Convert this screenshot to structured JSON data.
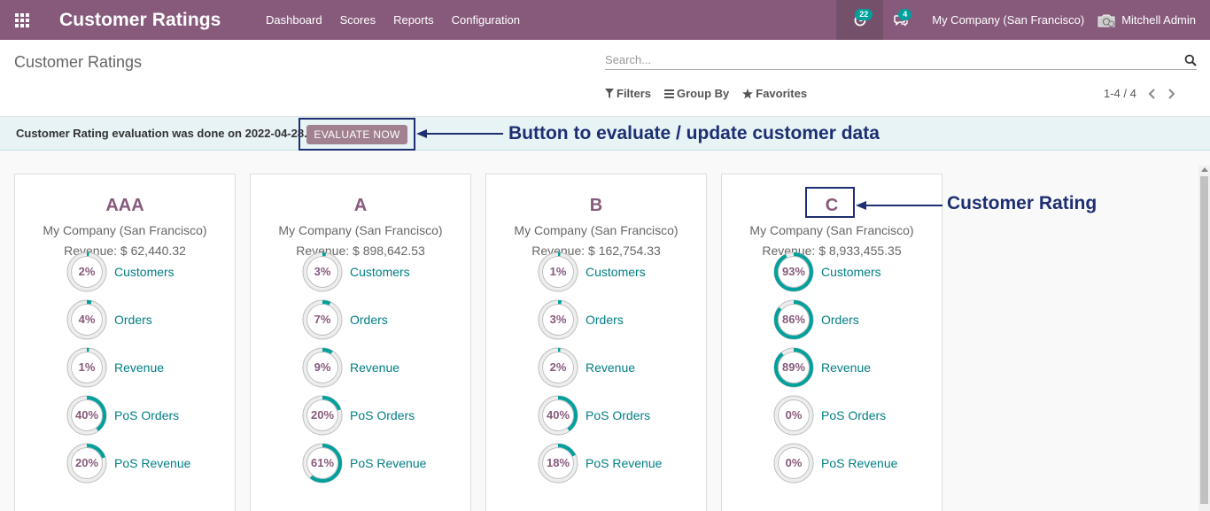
{
  "navbar": {
    "app_title": "Customer Ratings",
    "menu": [
      "Dashboard",
      "Scores",
      "Reports",
      "Configuration"
    ],
    "activity_count": "22",
    "message_count": "4",
    "company": "My Company (San Francisco)",
    "user": "Mitchell Admin"
  },
  "control_panel": {
    "title": "Customer Ratings",
    "search_placeholder": "Search...",
    "filters_label": "Filters",
    "group_by_label": "Group By",
    "favorites_label": "Favorites",
    "pager": "1-4 / 4"
  },
  "alert": {
    "text": "Customer Rating evaluation was done on 2022-04-28.",
    "button_label": "EVALUATE NOW",
    "annotation": "Button to evaluate / update customer data"
  },
  "rating_annotation": "Customer Rating",
  "colors": {
    "navbar": "#875a7b",
    "accent": "#00a09d",
    "link": "#017e84",
    "annotation": "#1d2f72"
  },
  "cards": [
    {
      "rating": "AAA",
      "company": "My Company (San Francisco)",
      "revenue": "Revenue: $ 62,440.32",
      "metrics": [
        {
          "pct": "2%",
          "value": 0.02,
          "label": "Customers"
        },
        {
          "pct": "4%",
          "value": 0.04,
          "label": "Orders"
        },
        {
          "pct": "1%",
          "value": 0.01,
          "label": "Revenue"
        },
        {
          "pct": "40%",
          "value": 0.4,
          "label": "PoS Orders"
        },
        {
          "pct": "20%",
          "value": 0.2,
          "label": "PoS Revenue"
        }
      ]
    },
    {
      "rating": "A",
      "company": "My Company (San Francisco)",
      "revenue": "Revenue: $ 898,642.53",
      "metrics": [
        {
          "pct": "3%",
          "value": 0.03,
          "label": "Customers"
        },
        {
          "pct": "7%",
          "value": 0.07,
          "label": "Orders"
        },
        {
          "pct": "9%",
          "value": 0.09,
          "label": "Revenue"
        },
        {
          "pct": "20%",
          "value": 0.2,
          "label": "PoS Orders"
        },
        {
          "pct": "61%",
          "value": 0.61,
          "label": "PoS Revenue"
        }
      ]
    },
    {
      "rating": "B",
      "company": "My Company (San Francisco)",
      "revenue": "Revenue: $ 162,754.33",
      "metrics": [
        {
          "pct": "1%",
          "value": 0.01,
          "label": "Customers"
        },
        {
          "pct": "3%",
          "value": 0.03,
          "label": "Orders"
        },
        {
          "pct": "2%",
          "value": 0.02,
          "label": "Revenue"
        },
        {
          "pct": "40%",
          "value": 0.4,
          "label": "PoS Orders"
        },
        {
          "pct": "18%",
          "value": 0.18,
          "label": "PoS Revenue"
        }
      ]
    },
    {
      "rating": "C",
      "company": "My Company (San Francisco)",
      "revenue": "Revenue: $ 8,933,455.35",
      "metrics": [
        {
          "pct": "93%",
          "value": 0.93,
          "label": "Customers"
        },
        {
          "pct": "86%",
          "value": 0.86,
          "label": "Orders"
        },
        {
          "pct": "89%",
          "value": 0.89,
          "label": "Revenue"
        },
        {
          "pct": "0%",
          "value": 0.0,
          "label": "PoS Orders"
        },
        {
          "pct": "0%",
          "value": 0.0,
          "label": "PoS Revenue"
        }
      ]
    }
  ]
}
